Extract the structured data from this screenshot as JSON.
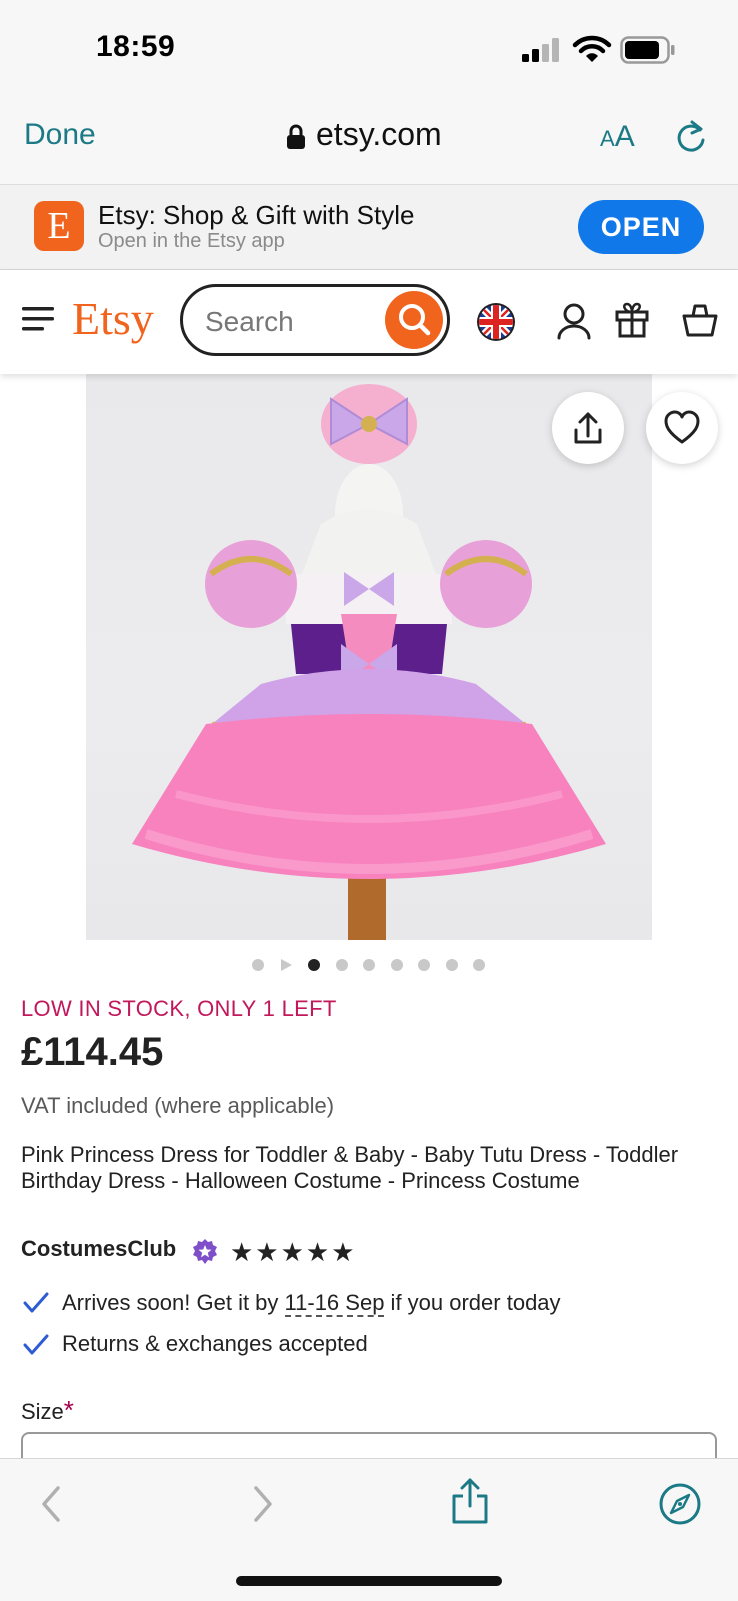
{
  "status_bar": {
    "time": "18:59"
  },
  "browser": {
    "done_label": "Done",
    "url": "etsy.com",
    "text_size_label_small": "A",
    "text_size_label_large": "A"
  },
  "app_banner": {
    "icon_letter": "E",
    "title": "Etsy: Shop & Gift with Style",
    "subtitle": "Open in the Etsy app",
    "open_label": "OPEN"
  },
  "header": {
    "logo": "Etsy",
    "search": {
      "placeholder": "Search",
      "value": ""
    }
  },
  "carousel": {
    "total_dots": 8,
    "active_index": 1
  },
  "product": {
    "stock_label": "LOW IN STOCK, ONLY 1 LEFT",
    "price": "£114.45",
    "vat_note": "VAT included (where applicable)",
    "title": "Pink Princess Dress for Toddler & Baby - Baby Tutu Dress - Toddler Birthday Dress - Halloween Costume - Princess Costume",
    "shop_name": "CostumesClub",
    "stars": "★★★★★",
    "rating": 5,
    "arrives_prefix": "Arrives soon! Get it by ",
    "arrives_date": "11-16 Sep",
    "arrives_suffix": " if you order today",
    "returns": "Returns & exchanges accepted",
    "size_label": "Size",
    "size_required_mark": "*"
  },
  "colors": {
    "etsy_orange": "#f1641e",
    "safari_teal": "#1b7a86",
    "open_blue": "#1078e8",
    "stock_red": "#c2185b",
    "check_blue": "#2f5bd3"
  }
}
